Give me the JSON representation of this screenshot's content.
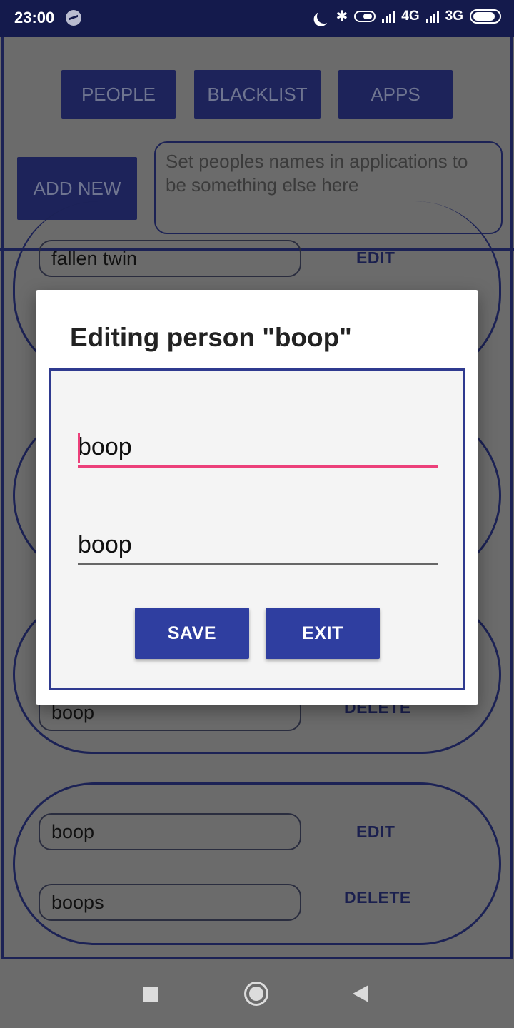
{
  "status_bar": {
    "time": "23:00",
    "network_1": "4G",
    "network_2": "3G",
    "icons": [
      "messenger-icon",
      "moon-icon",
      "bluetooth-icon",
      "data-saver-icon",
      "signal-icon",
      "signal-icon",
      "battery-icon"
    ]
  },
  "top_tabs": {
    "people": "PEOPLE",
    "blacklist": "BLACKLIST",
    "apps": "APPS"
  },
  "add_new_label": "ADD NEW",
  "info_text": "Set peoples names in applications to be something else here",
  "entries": [
    {
      "name": "fallen twin",
      "edit": "EDIT"
    },
    {
      "name": "boop",
      "delete": "DELETE"
    },
    {
      "name": "boop",
      "alias": "boops",
      "edit": "EDIT",
      "delete": "DELETE"
    }
  ],
  "dialog": {
    "title": "Editing person \"boop\"",
    "field1_value": "boop",
    "field2_value": "boop",
    "save_label": "SAVE",
    "exit_label": "EXIT"
  },
  "colors": {
    "accent": "#2f3ea0",
    "focus": "#ec407a",
    "status_bar": "#141a4c"
  }
}
